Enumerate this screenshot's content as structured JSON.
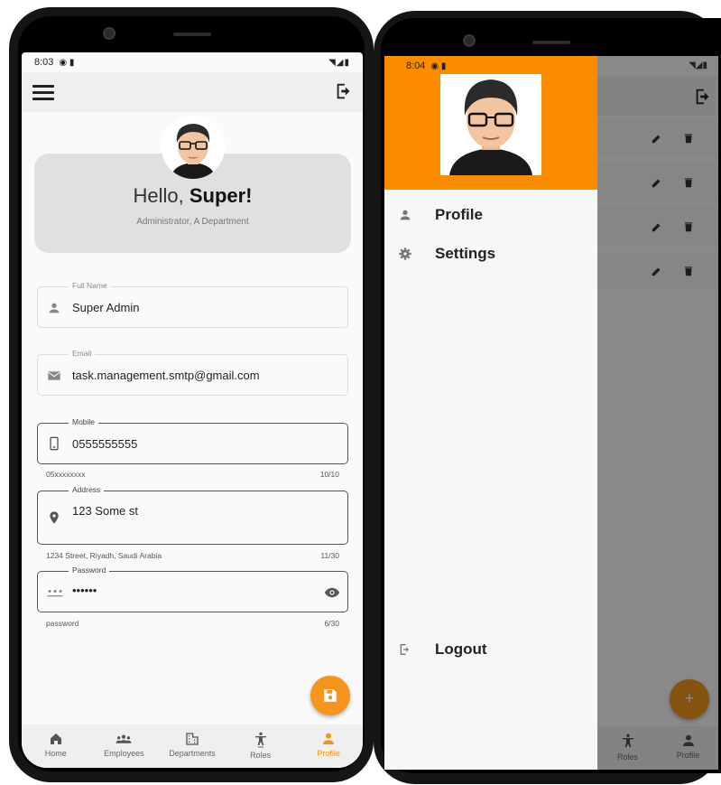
{
  "left": {
    "status": {
      "time": "8:03",
      "right": "◥◢▮"
    },
    "greeting": {
      "prefix": "Hello, ",
      "name": "Super!"
    },
    "subtitle": "Administrator, A Department",
    "fields": {
      "full_name": {
        "label": "Full Name",
        "value": "Super Admin"
      },
      "email": {
        "label": "Email",
        "value": "task.management.smtp@gmail.com"
      },
      "mobile": {
        "label": "Mobile",
        "value": "0555555555",
        "helper": "05xxxxxxxx",
        "counter": "10/10"
      },
      "address": {
        "label": "Address",
        "value": "123 Some st",
        "helper": "1234 Street, Riyadh, Saudi Arabia",
        "counter": "11/30"
      },
      "password": {
        "label": "Password",
        "value": "••••••",
        "helper": "password",
        "counter": "6/30"
      }
    },
    "bottom_nav": [
      {
        "label": "Home",
        "icon": "home-icon"
      },
      {
        "label": "Employees",
        "icon": "groups-icon"
      },
      {
        "label": "Departments",
        "icon": "building-icon"
      },
      {
        "label": "Roles",
        "icon": "accessibility-icon"
      },
      {
        "label": "Profile",
        "icon": "person-icon",
        "active": true
      }
    ],
    "accent": "#f5951e"
  },
  "right": {
    "status": {
      "time": "8:04",
      "right": "◥◢▮"
    },
    "drawer": {
      "header_color": "#fb8c00",
      "items": [
        {
          "label": "Profile",
          "icon": "person-icon"
        },
        {
          "label": "Settings",
          "icon": "gear-icon"
        }
      ],
      "logout": {
        "label": "Logout",
        "icon": "logout-icon"
      }
    },
    "bottom_nav": [
      {
        "label": "Roles",
        "icon": "accessibility-icon"
      },
      {
        "label": "Profile",
        "icon": "person-icon"
      }
    ]
  }
}
